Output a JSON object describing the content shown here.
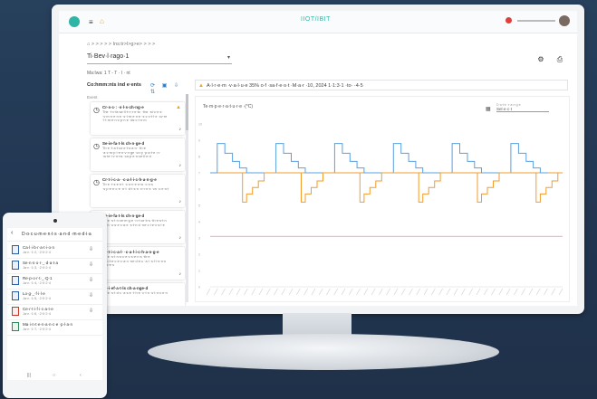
{
  "header": {
    "brand": "IIOT/IBIT",
    "breadcrumb": "⌂  > > > > > Ins:tr>l>g>e> > > >",
    "page_select_value": "Ti·Bev·l·rago·1",
    "sub_info": "Ma:Iwa: 1 T - T · I · nt"
  },
  "left_panel": {
    "title": "Co:hmm:nts ind e·ents",
    "icons": "⟳ ▣ ⇩ ⇅",
    "subtitle": "Event",
    "cards": [
      {
        "title": "Cr·s·c·: ·s·l·s·ch·ng·e",
        "body": "The ·t·v·fa·se·ll·t·n·r·e·ts· ·the ·st·c·n·s· ·v·m·n·e·n·e ·s·t·m·e·n·e ·s·c·v·t·l·e ·cv·re ·l·t·m·e·n·c·p·n·e ·ds·c·t·n·m",
        "warn": true
      },
      {
        "title": "Se·ie·fa·t·ls ch·n·ge·d",
        "body": "Th·e ·t·a·t·co·e·t·s·a·n· ·th·e ·a·c·m·p·i·e·n·v·n·ge ·cn·y ·p·a·t·e ·n· ·w·te·i·v·n·ns ·ca·p·e·n·ce·ll·e·d",
        "warn": false
      },
      {
        "title": "Cr·t·i·c·a· ·c·a·l·i·c·h·a·n·g·e",
        "body": "Th·e ·t·s·e·n·t ·c·o·n·e·n·w ·c·n·s ·s·p·e·n·c·e ·n·t ·d·t·s·n ·n·r·n·e ·vn ·c·e·n·t",
        "warn": false
      },
      {
        "title": "Se·ie·fa·t·ls ch·n·ge·d",
        "body": "Th·e ·s·t·n·ce·m·g·e ·n·r·ce·b·s ·th·e·s·t·n ·c·m ·u·s·e·c·a·e ·s·t·n·d ·ne·c·l·e·c·s·i·e",
        "warn": false
      },
      {
        "title": "Cr·t·i·c·a·l· ·c·a·l·i·c·h·a·n·g·e",
        "body": "Th·e ·s·t·n·s·c·e·c·s·e·n·s ·th·e ·s·p·t·e·c·e·c·a·n ·ne·d·e·c ·a·l ·s·l·i·e·n·n ·d·c·e·s",
        "warn": false
      },
      {
        "title": "Se·i·ef·a·t·ls ch·a·nge·d",
        "body": "Th·e ·s·t·d·c ·a·s·e ·t·h·e ·c·t·n ·s·t·n·c·e·n",
        "warn": false
      }
    ]
  },
  "alert": {
    "text": "A·l·r·e·m ·v·a·l·u·e 35% o·f ·sa·f·e·s·t ·M·a·r ·10, 2024 1·1:3·1 ·to· ·4·5"
  },
  "chart_data": {
    "type": "line",
    "title": "Te·m·p·e·r·a·t·u·r·e ·(°C)",
    "range_label": "D·a·t·e ·r·a·n·g·e",
    "range_value": "Sel·e·c·t",
    "y_tick_labels": [
      "10",
      "9",
      "8",
      "7",
      "6",
      "5",
      "4",
      "3",
      "2",
      "1",
      "0"
    ],
    "x_ticks_hint": "date/time labels (illegible)",
    "threshold_value": 7.0,
    "lower_limit_value": 3.1,
    "series": [
      {
        "name": "",
        "color": "#5aa0e0"
      },
      {
        "name": "",
        "color": "#f39c2c"
      }
    ],
    "grid": false,
    "legend": "none"
  },
  "phone": {
    "title": "D·o·c·u·m·e·n·t·s ·a·n·d ·m·e·d·i·a",
    "docs": [
      {
        "name": "Ca·l·i·b·r·a·t·i·o·n",
        "date": "Ja·n ·1·2, ·2·0·2·4"
      },
      {
        "name": "Se·n·s·o·r·_·d·a·t·a",
        "date": "Ja·n ·1·3, ·2·0·2·4"
      },
      {
        "name": "Re·p·o·r·t·_·Q·1",
        "date": "Ja·n ·1·4, ·2·0·2·4"
      },
      {
        "name": "Lo·g·_·f·i·l·e",
        "date": "Ja·n ·1·5, ·2·0·2·4"
      },
      {
        "name": "Ce·r·t·i·f·i·c·a·t·e",
        "date": "Ja·n ·1·6, ·2·0·2·4"
      },
      {
        "name": "Ma·i·n·t·e·n·a·n·c·e ·p·l·a·n",
        "date": "Ja·n ·1·7, ·2·0·2·4"
      }
    ],
    "nav": "|||     O     <"
  },
  "colors": {
    "accent": "#2fb5a6",
    "series_blue": "#5aa0e0",
    "series_orange": "#f39c2c",
    "limit_red": "#e57373",
    "background": "#233650"
  }
}
